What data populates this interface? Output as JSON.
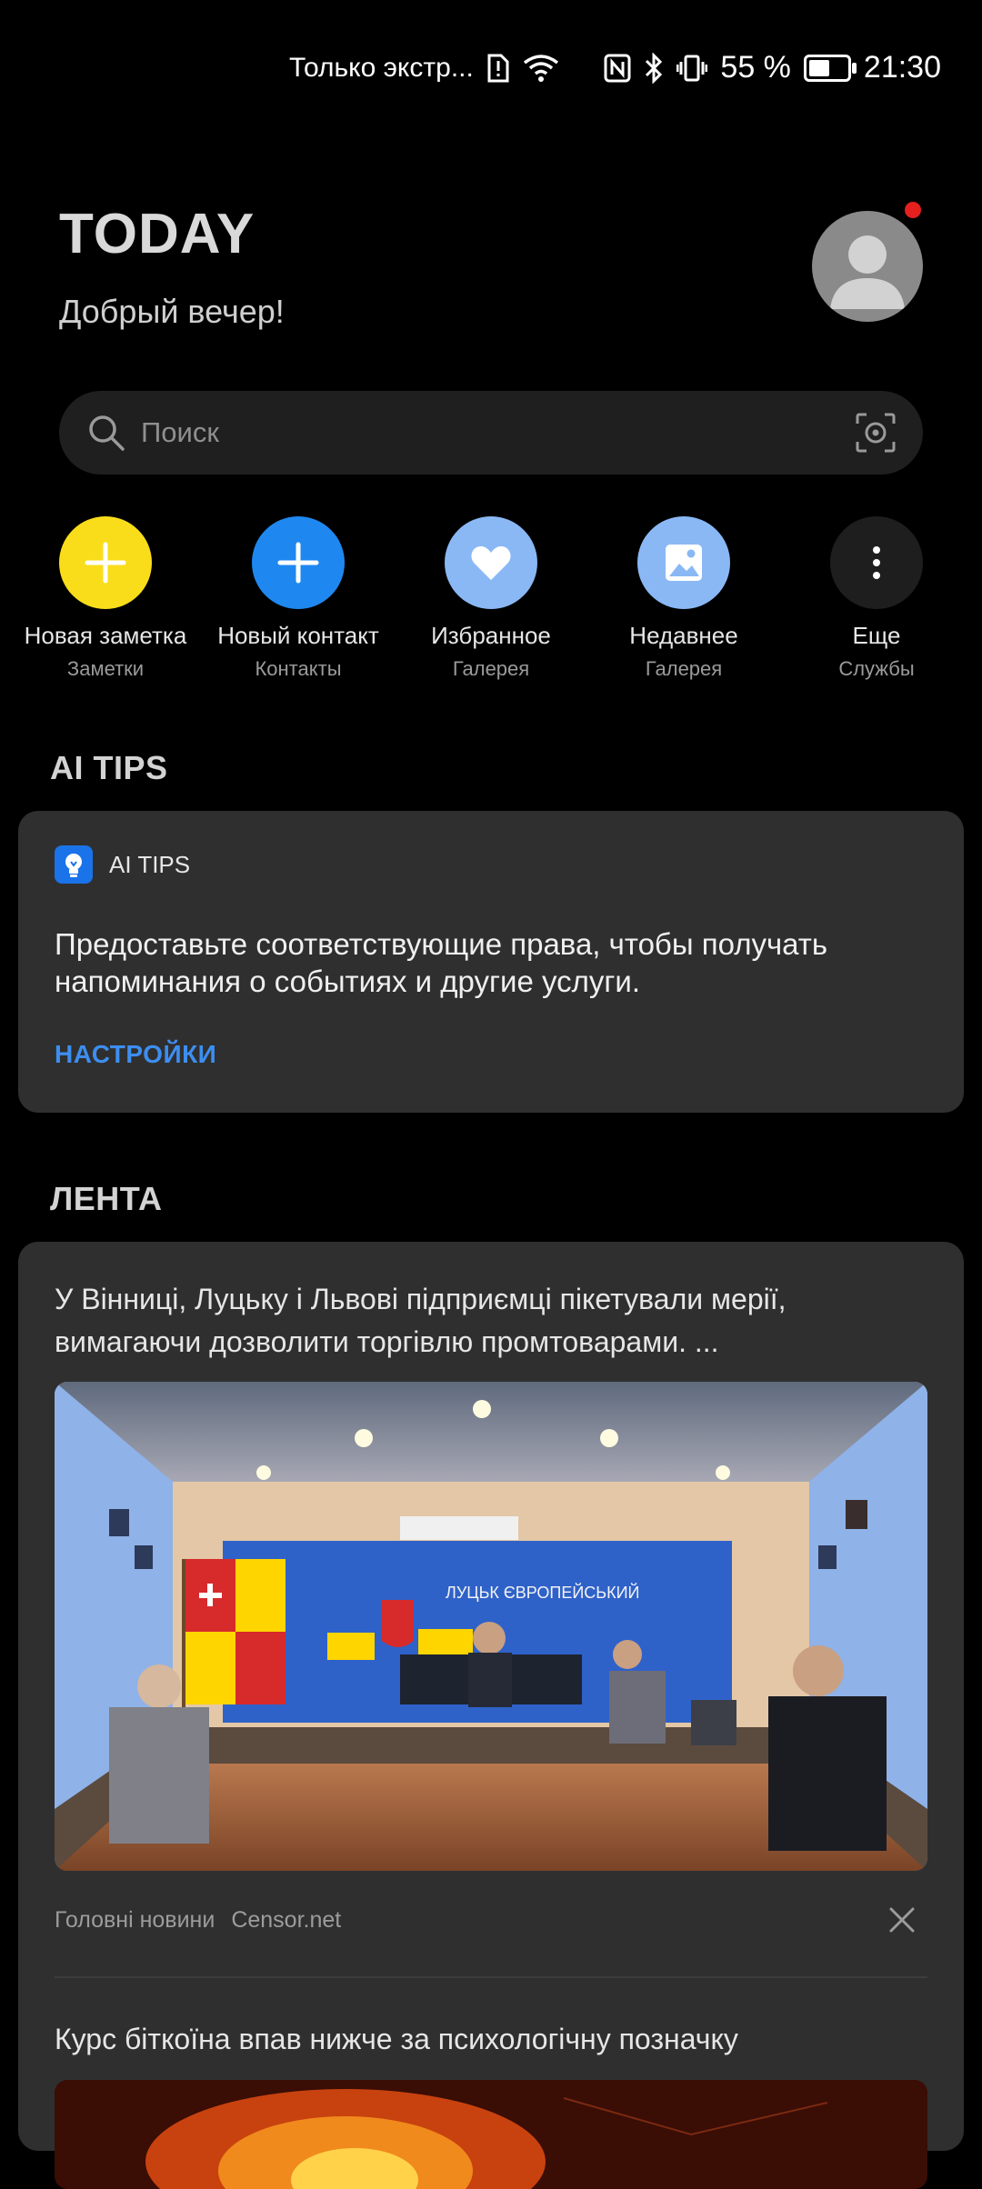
{
  "status_bar": {
    "carrier_text": "Только экстр...",
    "battery_text": "55 %",
    "battery_level": 0.55,
    "time": "21:30"
  },
  "header": {
    "title": "TODAY",
    "greeting": "Добрый вечер!"
  },
  "search": {
    "placeholder": "Поиск"
  },
  "shortcuts": [
    {
      "label": "Новая заметка",
      "sub": "Заметки",
      "icon": "plus-icon",
      "color": "#fadd1a"
    },
    {
      "label": "Новый контакт",
      "sub": "Контакты",
      "icon": "plus-icon",
      "color": "#1f88f0"
    },
    {
      "label": "Избранное",
      "sub": "Галерея",
      "icon": "heart-icon",
      "color": "#8ab8f5"
    },
    {
      "label": "Недавнее",
      "sub": "Галерея",
      "icon": "image-icon",
      "color": "#8ab8f5"
    },
    {
      "label": "Еще",
      "sub": "Службы",
      "icon": "more-vertical-icon",
      "color": "#1e1e1e"
    }
  ],
  "ai_tips": {
    "section_title": "AI TIPS",
    "card_label": "AI TIPS",
    "text": "Предоставьте соответствующие права, чтобы получать напоминания о событиях и другие услуги.",
    "action_label": "НАСТРОЙКИ",
    "accent_color": "#3d8ef0"
  },
  "feed": {
    "section_title": "ЛЕНТА",
    "items": [
      {
        "title": "У Вінниці, Луцьку і Львові підприємці пікетували мерії, вимагаючи дозволити торгівлю промтоварами. ...",
        "category": "Головні новини",
        "source": "Censor.net"
      },
      {
        "title": "Курс біткоїна впав нижче за психологічну позначку"
      }
    ]
  },
  "photo": {
    "banner_text": "ЛУЦЬК ЄВРОПЕЙСЬКИЙ"
  }
}
